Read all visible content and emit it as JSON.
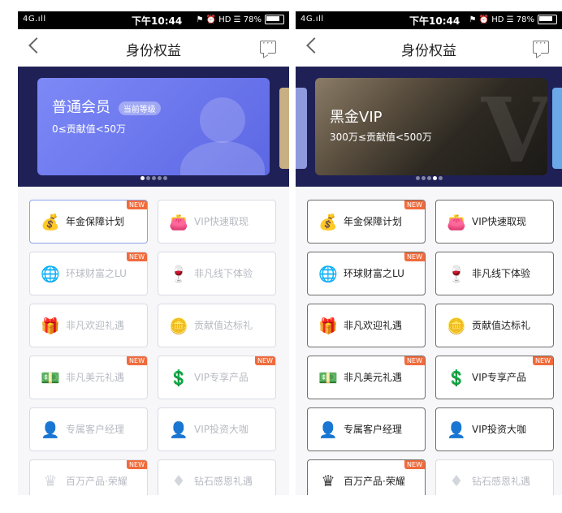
{
  "status_bar": {
    "network": "4G.ıll",
    "apps": "⚙ ···",
    "time": "下午10:44",
    "right": "⚑ ⏰ HD ☰ 78%"
  },
  "left": {
    "title": "身份权益",
    "card": {
      "name": "普通会员",
      "badge": "当前等级",
      "range": "0≤贡献值<50万"
    },
    "items": [
      {
        "label": "年金保障计划",
        "icon": "money-bag-icon",
        "glyph": "💰",
        "new": "NEW"
      },
      {
        "label": "VIP快速取现",
        "icon": "wallet-icon",
        "glyph": "👛",
        "new": ""
      },
      {
        "label": "环球财富之LU",
        "icon": "globe-icon",
        "glyph": "🌐",
        "new": "NEW"
      },
      {
        "label": "非凡线下体验",
        "icon": "wine-icon",
        "glyph": "🍷",
        "new": ""
      },
      {
        "label": "非凡欢迎礼遇",
        "icon": "gift-icon",
        "glyph": "🎁",
        "new": ""
      },
      {
        "label": "贡献值达标礼",
        "icon": "coin-icon",
        "glyph": "🪙",
        "new": ""
      },
      {
        "label": "非凡美元礼遇",
        "icon": "dollar-icon",
        "glyph": "💵",
        "new": "NEW"
      },
      {
        "label": "VIP专享产品",
        "icon": "vip-icon",
        "glyph": "💲",
        "new": "NEW"
      },
      {
        "label": "专属客户经理",
        "icon": "manager-icon",
        "glyph": "👤",
        "new": ""
      },
      {
        "label": "VIP投资大咖",
        "icon": "investor-icon",
        "glyph": "👤",
        "new": ""
      },
      {
        "label": "百万产品·荣耀",
        "icon": "crown-icon",
        "glyph": "♛",
        "new": "NEW"
      },
      {
        "label": "钻石感恩礼遇",
        "icon": "diamond-icon",
        "glyph": "♦",
        "new": ""
      }
    ]
  },
  "right": {
    "title": "身份权益",
    "card": {
      "name": "黑金VIP",
      "range": "300万≤贡献值<500万"
    },
    "items": [
      {
        "label": "年金保障计划",
        "icon": "money-bag-icon",
        "glyph": "💰",
        "new": "NEW"
      },
      {
        "label": "VIP快速取现",
        "icon": "wallet-icon",
        "glyph": "👛",
        "new": ""
      },
      {
        "label": "环球财富之LU",
        "icon": "globe-icon",
        "glyph": "🌐",
        "new": "NEW"
      },
      {
        "label": "非凡线下体验",
        "icon": "wine-icon",
        "glyph": "🍷",
        "new": ""
      },
      {
        "label": "非凡欢迎礼遇",
        "icon": "gift-icon",
        "glyph": "🎁",
        "new": ""
      },
      {
        "label": "贡献值达标礼",
        "icon": "coin-icon",
        "glyph": "🪙",
        "new": ""
      },
      {
        "label": "非凡美元礼遇",
        "icon": "dollar-icon",
        "glyph": "💵",
        "new": "NEW"
      },
      {
        "label": "VIP专享产品",
        "icon": "vip-icon",
        "glyph": "💲",
        "new": "NEW"
      },
      {
        "label": "专属客户经理",
        "icon": "manager-icon",
        "glyph": "👤",
        "new": ""
      },
      {
        "label": "VIP投资大咖",
        "icon": "investor-icon",
        "glyph": "👤",
        "new": ""
      },
      {
        "label": "百万产品·荣耀",
        "icon": "crown-icon",
        "glyph": "♛",
        "new": "NEW"
      },
      {
        "label": "钻石感恩礼遇",
        "icon": "diamond-icon",
        "glyph": "♦",
        "new": ""
      }
    ]
  },
  "colors": {
    "hero_bg": "#1f2156",
    "blue_card": "#6b77ee",
    "new_badge": "#f06b3c"
  }
}
